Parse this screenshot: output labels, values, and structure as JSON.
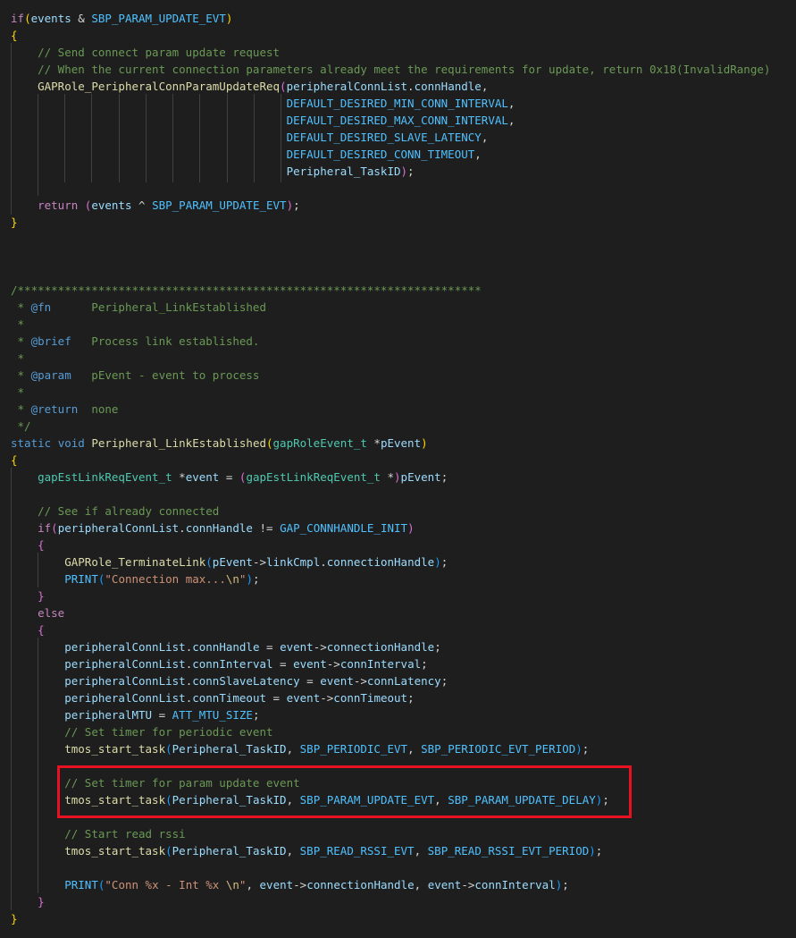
{
  "theme": {
    "background": "#1e1e1e",
    "highlight_box": "#e81123",
    "token_colors": {
      "kw": "#569cd6",
      "ctl": "#c586c0",
      "fn": "#dcdcaa",
      "var": "#9cdcfe",
      "type": "#4ec9b0",
      "mac": "#4fc1ff",
      "str": "#ce9178",
      "num": "#b5cea8",
      "com": "#6a9955",
      "cdoc": "#569cd6",
      "br1": "#ffd700",
      "br2": "#da70d6",
      "br3": "#179fff",
      "op": "#d4d4d4",
      "esc": "#d7ba7d"
    }
  },
  "code": {
    "lines": [
      [
        [
          "ctl",
          "if"
        ],
        [
          "br1",
          "("
        ],
        [
          "var",
          "events"
        ],
        [
          "op",
          " & "
        ],
        [
          "mac",
          "SBP_PARAM_UPDATE_EVT"
        ],
        [
          "br1",
          ")"
        ]
      ],
      [
        [
          "br1",
          "{"
        ]
      ],
      [
        [
          "op",
          "    "
        ],
        [
          "com",
          "// Send connect param update request"
        ]
      ],
      [
        [
          "op",
          "    "
        ],
        [
          "com",
          "// When the current connection parameters already meet the requirements for update, return 0x18(InvalidRange)"
        ]
      ],
      [
        [
          "op",
          "    "
        ],
        [
          "fn",
          "GAPRole_PeripheralConnParamUpdateReq"
        ],
        [
          "br2",
          "("
        ],
        [
          "var",
          "peripheralConnList"
        ],
        [
          "op",
          "."
        ],
        [
          "var",
          "connHandle"
        ],
        [
          "op",
          ","
        ]
      ],
      [
        [
          "op",
          "                                         "
        ],
        [
          "mac",
          "DEFAULT_DESIRED_MIN_CONN_INTERVAL"
        ],
        [
          "op",
          ","
        ]
      ],
      [
        [
          "op",
          "                                         "
        ],
        [
          "mac",
          "DEFAULT_DESIRED_MAX_CONN_INTERVAL"
        ],
        [
          "op",
          ","
        ]
      ],
      [
        [
          "op",
          "                                         "
        ],
        [
          "mac",
          "DEFAULT_DESIRED_SLAVE_LATENCY"
        ],
        [
          "op",
          ","
        ]
      ],
      [
        [
          "op",
          "                                         "
        ],
        [
          "mac",
          "DEFAULT_DESIRED_CONN_TIMEOUT"
        ],
        [
          "op",
          ","
        ]
      ],
      [
        [
          "op",
          "                                         "
        ],
        [
          "var",
          "Peripheral_TaskID"
        ],
        [
          "br2",
          ")"
        ],
        [
          "op",
          ";"
        ]
      ],
      [],
      [
        [
          "op",
          "    "
        ],
        [
          "ctl",
          "return"
        ],
        [
          "op",
          " "
        ],
        [
          "br2",
          "("
        ],
        [
          "var",
          "events"
        ],
        [
          "op",
          " ^ "
        ],
        [
          "mac",
          "SBP_PARAM_UPDATE_EVT"
        ],
        [
          "br2",
          ")"
        ],
        [
          "op",
          ";"
        ]
      ],
      [
        [
          "br1",
          "}"
        ]
      ],
      [],
      [],
      [],
      [
        [
          "com",
          "/*********************************************************************"
        ]
      ],
      [
        [
          "com",
          " * "
        ],
        [
          "cdoc",
          "@fn"
        ],
        [
          "com",
          "      Peripheral_LinkEstablished"
        ]
      ],
      [
        [
          "com",
          " *"
        ]
      ],
      [
        [
          "com",
          " * "
        ],
        [
          "cdoc",
          "@brief"
        ],
        [
          "com",
          "   Process link established."
        ]
      ],
      [
        [
          "com",
          " *"
        ]
      ],
      [
        [
          "com",
          " * "
        ],
        [
          "cdoc",
          "@param"
        ],
        [
          "com",
          "   pEvent - event to process"
        ]
      ],
      [
        [
          "com",
          " *"
        ]
      ],
      [
        [
          "com",
          " * "
        ],
        [
          "cdoc",
          "@return"
        ],
        [
          "com",
          "  none"
        ]
      ],
      [
        [
          "com",
          " */"
        ]
      ],
      [
        [
          "kw",
          "static"
        ],
        [
          "op",
          " "
        ],
        [
          "kw",
          "void"
        ],
        [
          "op",
          " "
        ],
        [
          "fn",
          "Peripheral_LinkEstablished"
        ],
        [
          "br1",
          "("
        ],
        [
          "type",
          "gapRoleEvent_t"
        ],
        [
          "op",
          " *"
        ],
        [
          "var",
          "pEvent"
        ],
        [
          "br1",
          ")"
        ]
      ],
      [
        [
          "br1",
          "{"
        ]
      ],
      [
        [
          "op",
          "    "
        ],
        [
          "type",
          "gapEstLinkReqEvent_t"
        ],
        [
          "op",
          " *"
        ],
        [
          "var",
          "event"
        ],
        [
          "op",
          " = "
        ],
        [
          "br2",
          "("
        ],
        [
          "type",
          "gapEstLinkReqEvent_t"
        ],
        [
          "op",
          " *"
        ],
        [
          "br2",
          ")"
        ],
        [
          "var",
          "pEvent"
        ],
        [
          "op",
          ";"
        ]
      ],
      [],
      [
        [
          "op",
          "    "
        ],
        [
          "com",
          "// See if already connected"
        ]
      ],
      [
        [
          "op",
          "    "
        ],
        [
          "ctl",
          "if"
        ],
        [
          "br2",
          "("
        ],
        [
          "var",
          "peripheralConnList"
        ],
        [
          "op",
          "."
        ],
        [
          "var",
          "connHandle"
        ],
        [
          "op",
          " != "
        ],
        [
          "mac",
          "GAP_CONNHANDLE_INIT"
        ],
        [
          "br2",
          ")"
        ]
      ],
      [
        [
          "op",
          "    "
        ],
        [
          "br2",
          "{"
        ]
      ],
      [
        [
          "op",
          "        "
        ],
        [
          "fn",
          "GAPRole_TerminateLink"
        ],
        [
          "br3",
          "("
        ],
        [
          "var",
          "pEvent"
        ],
        [
          "op",
          "->"
        ],
        [
          "var",
          "linkCmpl"
        ],
        [
          "op",
          "."
        ],
        [
          "var",
          "connectionHandle"
        ],
        [
          "br3",
          ")"
        ],
        [
          "op",
          ";"
        ]
      ],
      [
        [
          "op",
          "        "
        ],
        [
          "mac",
          "PRINT"
        ],
        [
          "br3",
          "("
        ],
        [
          "str",
          "\"Connection max..."
        ],
        [
          "esc",
          "\\n"
        ],
        [
          "str",
          "\""
        ],
        [
          "br3",
          ")"
        ],
        [
          "op",
          ";"
        ]
      ],
      [
        [
          "op",
          "    "
        ],
        [
          "br2",
          "}"
        ]
      ],
      [
        [
          "op",
          "    "
        ],
        [
          "ctl",
          "else"
        ]
      ],
      [
        [
          "op",
          "    "
        ],
        [
          "br2",
          "{"
        ]
      ],
      [
        [
          "op",
          "        "
        ],
        [
          "var",
          "peripheralConnList"
        ],
        [
          "op",
          "."
        ],
        [
          "var",
          "connHandle"
        ],
        [
          "op",
          " = "
        ],
        [
          "var",
          "event"
        ],
        [
          "op",
          "->"
        ],
        [
          "var",
          "connectionHandle"
        ],
        [
          "op",
          ";"
        ]
      ],
      [
        [
          "op",
          "        "
        ],
        [
          "var",
          "peripheralConnList"
        ],
        [
          "op",
          "."
        ],
        [
          "var",
          "connInterval"
        ],
        [
          "op",
          " = "
        ],
        [
          "var",
          "event"
        ],
        [
          "op",
          "->"
        ],
        [
          "var",
          "connInterval"
        ],
        [
          "op",
          ";"
        ]
      ],
      [
        [
          "op",
          "        "
        ],
        [
          "var",
          "peripheralConnList"
        ],
        [
          "op",
          "."
        ],
        [
          "var",
          "connSlaveLatency"
        ],
        [
          "op",
          " = "
        ],
        [
          "var",
          "event"
        ],
        [
          "op",
          "->"
        ],
        [
          "var",
          "connLatency"
        ],
        [
          "op",
          ";"
        ]
      ],
      [
        [
          "op",
          "        "
        ],
        [
          "var",
          "peripheralConnList"
        ],
        [
          "op",
          "."
        ],
        [
          "var",
          "connTimeout"
        ],
        [
          "op",
          " = "
        ],
        [
          "var",
          "event"
        ],
        [
          "op",
          "->"
        ],
        [
          "var",
          "connTimeout"
        ],
        [
          "op",
          ";"
        ]
      ],
      [
        [
          "op",
          "        "
        ],
        [
          "var",
          "peripheralMTU"
        ],
        [
          "op",
          " = "
        ],
        [
          "mac",
          "ATT_MTU_SIZE"
        ],
        [
          "op",
          ";"
        ]
      ],
      [
        [
          "op",
          "        "
        ],
        [
          "com",
          "// Set timer for periodic event"
        ]
      ],
      [
        [
          "op",
          "        "
        ],
        [
          "fn",
          "tmos_start_task"
        ],
        [
          "br3",
          "("
        ],
        [
          "var",
          "Peripheral_TaskID"
        ],
        [
          "op",
          ", "
        ],
        [
          "mac",
          "SBP_PERIODIC_EVT"
        ],
        [
          "op",
          ", "
        ],
        [
          "mac",
          "SBP_PERIODIC_EVT_PERIOD"
        ],
        [
          "br3",
          ")"
        ],
        [
          "op",
          ";"
        ]
      ],
      [],
      [
        [
          "op",
          "        "
        ],
        [
          "com",
          "// Set timer for param update event"
        ]
      ],
      [
        [
          "op",
          "        "
        ],
        [
          "fn",
          "tmos_start_task"
        ],
        [
          "br3",
          "("
        ],
        [
          "var",
          "Peripheral_TaskID"
        ],
        [
          "op",
          ", "
        ],
        [
          "mac",
          "SBP_PARAM_UPDATE_EVT"
        ],
        [
          "op",
          ", "
        ],
        [
          "mac",
          "SBP_PARAM_UPDATE_DELAY"
        ],
        [
          "br3",
          ")"
        ],
        [
          "op",
          ";"
        ]
      ],
      [],
      [
        [
          "op",
          "        "
        ],
        [
          "com",
          "// Start read rssi"
        ]
      ],
      [
        [
          "op",
          "        "
        ],
        [
          "fn",
          "tmos_start_task"
        ],
        [
          "br3",
          "("
        ],
        [
          "var",
          "Peripheral_TaskID"
        ],
        [
          "op",
          ", "
        ],
        [
          "mac",
          "SBP_READ_RSSI_EVT"
        ],
        [
          "op",
          ", "
        ],
        [
          "mac",
          "SBP_READ_RSSI_EVT_PERIOD"
        ],
        [
          "br3",
          ")"
        ],
        [
          "op",
          ";"
        ]
      ],
      [],
      [
        [
          "op",
          "        "
        ],
        [
          "mac",
          "PRINT"
        ],
        [
          "br3",
          "("
        ],
        [
          "str",
          "\"Conn %x - Int %x "
        ],
        [
          "esc",
          "\\n"
        ],
        [
          "str",
          "\""
        ],
        [
          "op",
          ", "
        ],
        [
          "var",
          "event"
        ],
        [
          "op",
          "->"
        ],
        [
          "var",
          "connectionHandle"
        ],
        [
          "op",
          ", "
        ],
        [
          "var",
          "event"
        ],
        [
          "op",
          "->"
        ],
        [
          "var",
          "connInterval"
        ],
        [
          "br3",
          ")"
        ],
        [
          "op",
          ";"
        ]
      ],
      [
        [
          "op",
          "    "
        ],
        [
          "br2",
          "}"
        ]
      ],
      [
        [
          "br1",
          "}"
        ]
      ]
    ]
  }
}
